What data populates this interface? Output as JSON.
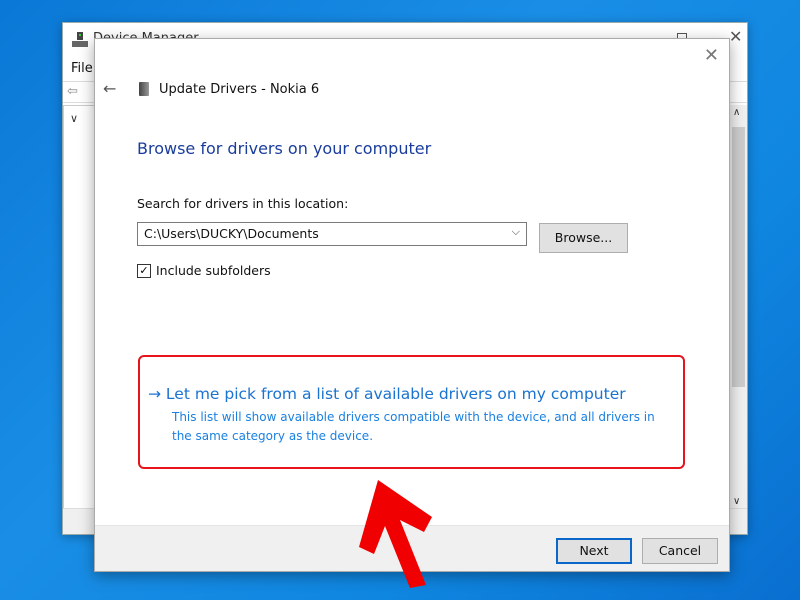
{
  "background_window": {
    "title": "Device Manager",
    "menu_file": "File"
  },
  "dialog": {
    "window_title": "Update Drivers - Nokia 6",
    "heading": "Browse for drivers on your computer",
    "search_label": "Search for drivers in this location:",
    "path_value": "C:\\Users\\DUCKY\\Documents",
    "browse_label": "Browse...",
    "include_subfolders_label": "Include subfolders",
    "include_subfolders_checked": true,
    "pick_option_title": "Let me pick from a list of available drivers on my computer",
    "pick_option_description": "This list will show available drivers compatible with the device, and all drivers in the same category as the device.",
    "next_label": "Next",
    "cancel_label": "Cancel"
  },
  "annotation": {
    "highlight_color": "#e8141b",
    "arrow_color": "#f00000"
  }
}
